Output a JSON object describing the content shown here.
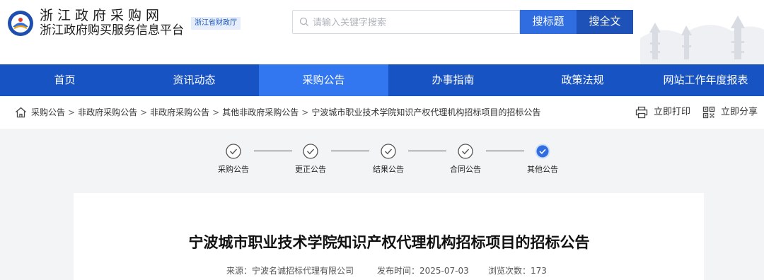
{
  "header": {
    "site_name": "浙江政府采购网",
    "site_subtitle": "浙江政府购买服务信息平台",
    "dept_badge": "浙江省财政厅",
    "search_placeholder": "请输入关键字搜索",
    "btn_search_title": "搜标题",
    "btn_search_full": "搜全文"
  },
  "nav": {
    "items": [
      "首页",
      "资讯动态",
      "采购公告",
      "办事指南",
      "政策法规",
      "网站工作年度报表"
    ],
    "active_index": 2
  },
  "breadcrumb": {
    "items": [
      "采购公告",
      "非政府采购公告",
      "非政府采购公告",
      "其他非政府采购公告",
      "宁波城市职业技术学院知识产权代理机构招标项目的招标公告"
    ],
    "separator": ">"
  },
  "tools": {
    "print": "立即打印",
    "share": "立即分享"
  },
  "steps": {
    "items": [
      "采购公告",
      "更正公告",
      "结果公告",
      "合同公告",
      "其他公告"
    ],
    "active_index": 4
  },
  "article": {
    "title": "宁波城市职业技术学院知识产权代理机构招标项目的招标公告",
    "source_label": "来源：",
    "source": "宁波名诚招标代理有限公司",
    "date_label": "发布时间：",
    "date": "2025-07-03",
    "views_label": "浏览次数：",
    "views": "173"
  },
  "colors": {
    "nav_bg": "#1853c4",
    "nav_active": "#3277ef",
    "btn_title": "#2f6de1",
    "btn_full": "#1e52b8",
    "step_active": "#2f6de1"
  }
}
